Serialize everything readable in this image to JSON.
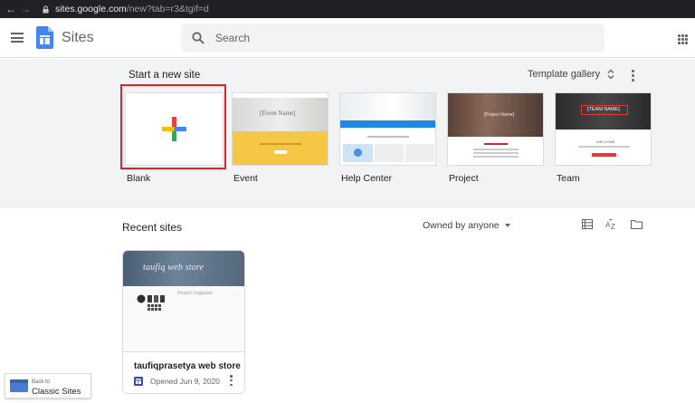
{
  "browser": {
    "url_host": "sites.google.com",
    "url_path": "/new?tab=r3&tgif=d"
  },
  "header": {
    "app_title": "Sites",
    "search_placeholder": "Search"
  },
  "templates": {
    "section_title": "Start a new site",
    "gallery_label": "Template gallery",
    "items": [
      {
        "label": "Blank"
      },
      {
        "label": "Event",
        "thumb_text": "[Event Name]"
      },
      {
        "label": "Help Center"
      },
      {
        "label": "Project",
        "thumb_text": "[Project Name]"
      },
      {
        "label": "Team",
        "thumb_text": "[TEAM NAME]",
        "thumb_sub": "WELCOME"
      }
    ]
  },
  "recent": {
    "title": "Recent sites",
    "owner_filter": "Owned by anyone",
    "sites": [
      {
        "thumb_title": "taufiq web store",
        "thumb_sub": "Produk Unggulan",
        "name": "taufiqprasetya web store",
        "opened": "Opened Jun 9, 2020"
      }
    ]
  },
  "classic": {
    "small_label": "Back to",
    "big_label": "Classic Sites"
  },
  "colors": {
    "sites_blue": "#4285f4",
    "selection_red": "#e51e25",
    "event_yellow": "#f6c744"
  },
  "icons": [
    "back-arrow-icon",
    "forward-arrow-icon",
    "lock-icon",
    "hamburger-icon",
    "sites-logo-icon",
    "search-icon",
    "apps-grid-icon",
    "unfold-icon",
    "more-vert-icon",
    "plus-icon",
    "caret-down-icon",
    "list-view-icon",
    "sort-az-icon",
    "folder-icon",
    "site-doc-icon"
  ]
}
